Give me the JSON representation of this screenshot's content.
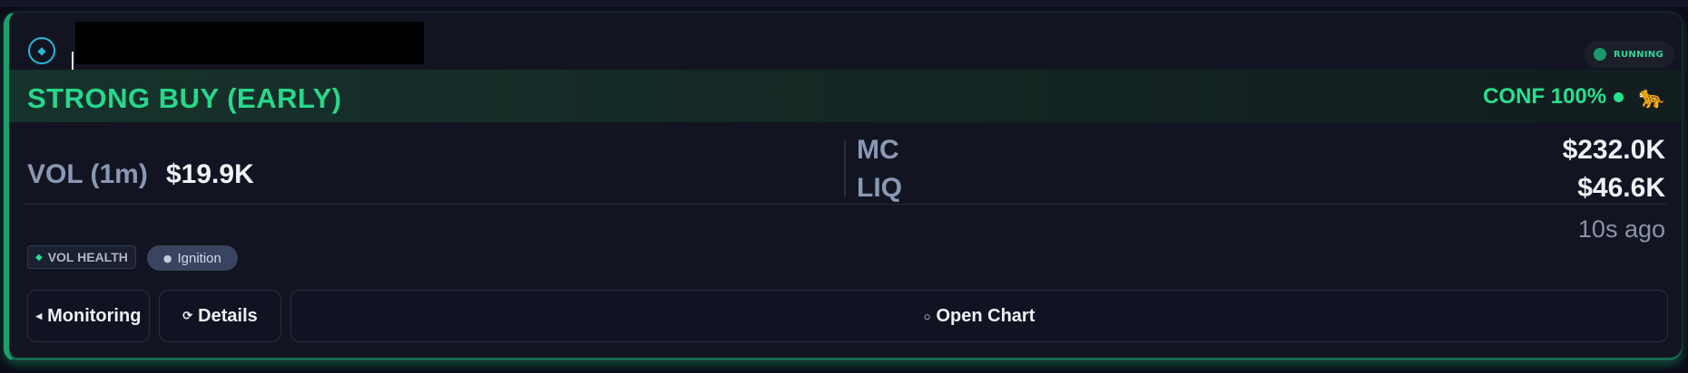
{
  "colors": {
    "accent_green": "#27d88a",
    "card_bg": "#121521",
    "page_bg": "#0b0c18",
    "label_gray": "#8a98b4",
    "value_white": "#f0f2f7",
    "icon_cyan": "#28b8d6"
  },
  "header": {
    "token_icon": "diamond-icon",
    "name_redacted": true,
    "status": {
      "label": "RUNNING",
      "icon": "status-dot-icon"
    }
  },
  "signal": {
    "title": "STRONG BUY (EARLY)",
    "confidence": "CONF 100%",
    "confidence_icon": "green-dot-icon",
    "emoji": "🐆"
  },
  "metrics": {
    "volume": {
      "label": "VOL (1m)",
      "value": "$19.9K"
    },
    "market_cap": {
      "label": "MC",
      "value": "$232.0K"
    },
    "liquidity": {
      "label": "LIQ",
      "value": "$46.6K"
    }
  },
  "timestamp": "10s ago",
  "tags": {
    "health": {
      "label": "VOL HEALTH",
      "icon": "◆"
    },
    "phase": {
      "label": "Ignition",
      "icon": "●"
    }
  },
  "actions": {
    "monitoring": {
      "icon": "◂",
      "label": "Monitoring"
    },
    "details": {
      "icon": "⟳",
      "label": "Details"
    },
    "open_chart": {
      "icon": "○",
      "label": "Open Chart"
    }
  }
}
